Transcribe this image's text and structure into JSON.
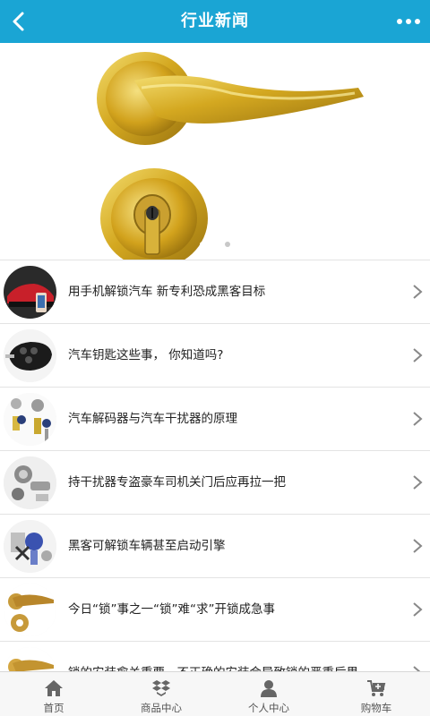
{
  "header": {
    "title": "行业新闻",
    "back_icon": "chevron-left-icon",
    "more_icon": "more-dots-icon",
    "background": "#1aa5d4"
  },
  "banner": {
    "image": "gold-door-lock-lever-handle",
    "slides": 2,
    "active_slide": 1
  },
  "news": [
    {
      "title": "用手机解锁汽车 新专利恐成黑客目标",
      "thumb": "red-car-phone-unlock"
    },
    {
      "title": "汽车钥匙这些事，  你知道吗?",
      "thumb": "car-key-fob"
    },
    {
      "title": "汽车解码器与汽车干扰器的原理",
      "thumb": "car-keys-and-cylinders"
    },
    {
      "title": "持干扰器专盗豪车司机关门后应再拉一把",
      "thumb": "lock-cylinders"
    },
    {
      "title": "黑客可解锁车辆甚至启动引擎",
      "thumb": "hacker-tools"
    },
    {
      "title": "今日“锁”事之一“锁”难“求”开锁成急事",
      "thumb": "gold-door-handle"
    },
    {
      "title": "锁的安装愈关重要，不正确的安装会导致锁的严重后果",
      "thumb": "gold-door-handle-2"
    }
  ],
  "tabbar": [
    {
      "label": "首页",
      "icon": "home-icon"
    },
    {
      "label": "商品中心",
      "icon": "dropbox-box-icon"
    },
    {
      "label": "个人中心",
      "icon": "user-icon"
    },
    {
      "label": "购物车",
      "icon": "cart-icon"
    }
  ]
}
